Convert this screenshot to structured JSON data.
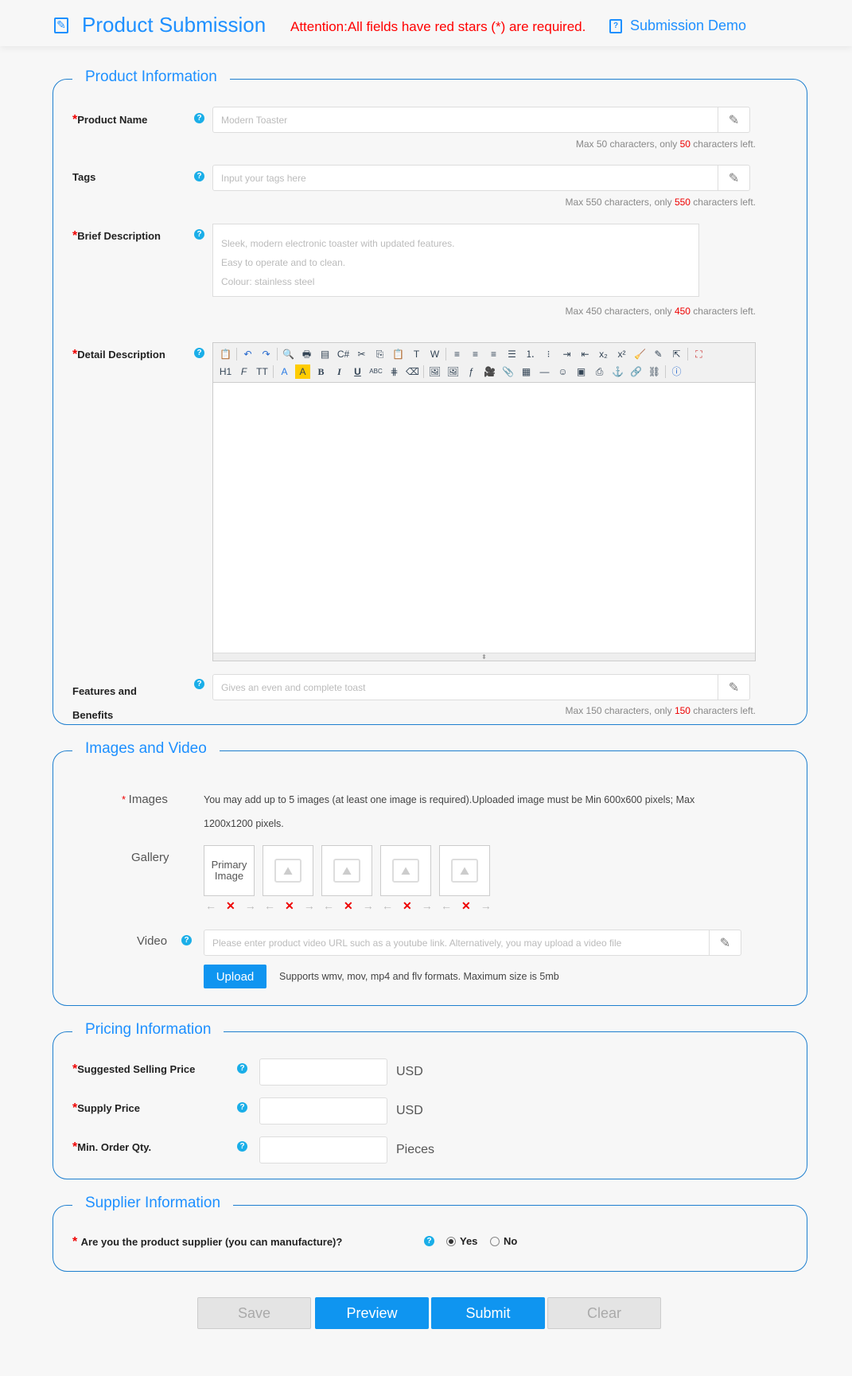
{
  "header": {
    "title": "Product Submission",
    "attention": "Attention:All fields have red stars (*) are required.",
    "demo_link": "Submission Demo"
  },
  "product_info": {
    "legend": "Product Information",
    "product_name": {
      "label": "Product Name",
      "placeholder": "Modern Toaster",
      "hint_pre": "Max 50 characters, only ",
      "hint_num": "50",
      "hint_post": " characters left."
    },
    "tags": {
      "label": "Tags",
      "placeholder": "Input your tags here",
      "hint_pre": "Max 550 characters, only ",
      "hint_num": "550",
      "hint_post": " characters left."
    },
    "brief": {
      "label": "Brief Description",
      "placeholder_lines": [
        "Sleek, modern electronic toaster with updated features.",
        "Easy to operate and to clean.",
        "Colour: stainless steel"
      ],
      "hint_pre": "Max 450 characters, only ",
      "hint_num": "450",
      "hint_post": " characters left."
    },
    "detail": {
      "label": "Detail Description"
    },
    "features": {
      "label_1": "Features and",
      "label_2": "Benefits",
      "placeholder": "Gives an even and complete toast",
      "hint_pre": "Max 150 characters, only ",
      "hint_num": "150",
      "hint_post": " characters left."
    }
  },
  "images_video": {
    "legend": "Images and Video",
    "images_label": "Images",
    "images_note": "You may add up to 5 images (at least one image is required).Uploaded image must be Min 600x600 pixels; Max 1200x1200 pixels.",
    "gallery_label": "Gallery",
    "primary": "Primary Image",
    "video_label": "Video",
    "video_placeholder": "Please enter product video URL such as a youtube link. Alternatively, you may upload a video file",
    "upload": "Upload",
    "upload_note": "Supports wmv, mov, mp4 and flv formats. Maximum size is 5mb"
  },
  "pricing": {
    "legend": "Pricing Information",
    "ssp": "Suggested Selling Price",
    "supply": "Supply Price",
    "moq": "Min. Order Qty.",
    "usd": "USD",
    "pieces": "Pieces"
  },
  "supplier": {
    "legend": "Supplier Information",
    "question": "Are you the product supplier (you can manufacture)?",
    "yes": "Yes",
    "no": "No"
  },
  "buttons": {
    "save": "Save",
    "preview": "Preview",
    "submit": "Submit",
    "clear": "Clear"
  },
  "toolbar": {
    "h1": "H1",
    "font": "F",
    "size": "TT",
    "color": "A",
    "bold": "B",
    "italic": "I",
    "underline": "U",
    "strike": "ABC"
  }
}
